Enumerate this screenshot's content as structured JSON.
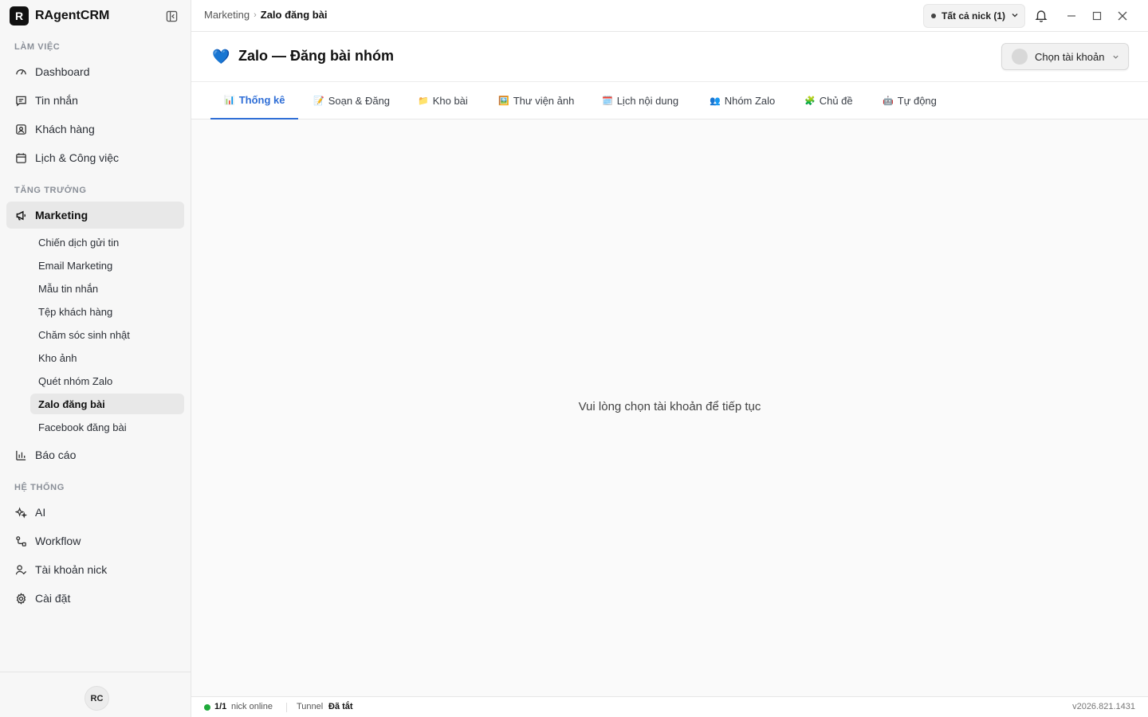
{
  "app": {
    "logo_letter": "R",
    "name": "RAgentCRM"
  },
  "sidebar": {
    "sections": [
      {
        "label": "LÀM VIỆC"
      },
      {
        "label": "TĂNG TRƯỞNG"
      },
      {
        "label": "HỆ THỐNG"
      }
    ],
    "items": [
      {
        "label": "Dashboard",
        "icon": "dashboard-icon"
      },
      {
        "label": "Tin nhắn",
        "icon": "message-icon"
      },
      {
        "label": "Khách hàng",
        "icon": "contact-icon"
      },
      {
        "label": "Lịch & Công việc",
        "icon": "calendar-icon"
      },
      {
        "label": "Marketing",
        "icon": "megaphone-icon"
      },
      {
        "label": "Báo cáo",
        "icon": "bar-chart-icon"
      },
      {
        "label": "AI",
        "icon": "sparkles-icon"
      },
      {
        "label": "Workflow",
        "icon": "workflow-icon"
      },
      {
        "label": "Tài khoản nick",
        "icon": "user-check-icon"
      },
      {
        "label": "Cài đặt",
        "icon": "gear-icon"
      }
    ],
    "marketing_sub": [
      {
        "label": "Chiến dịch gửi tin"
      },
      {
        "label": "Email Marketing"
      },
      {
        "label": "Mẫu tin nhắn"
      },
      {
        "label": "Tệp khách hàng"
      },
      {
        "label": "Chăm sóc sinh nhật"
      },
      {
        "label": "Kho ảnh"
      },
      {
        "label": "Quét nhóm Zalo"
      },
      {
        "label": "Zalo đăng bài"
      },
      {
        "label": "Facebook đăng bài"
      }
    ],
    "user_initials": "RC"
  },
  "topbar": {
    "breadcrumb_parent": "Marketing",
    "breadcrumb_sep": "›",
    "breadcrumb_current": "Zalo đăng bài",
    "nick_filter": "Tất cả nick (1)"
  },
  "page": {
    "icon": "💙",
    "title": "Zalo — Đăng bài nhóm",
    "account_select": "Chọn tài khoản"
  },
  "tabs": [
    {
      "emoji": "📊",
      "label": "Thống kê"
    },
    {
      "emoji": "📝",
      "label": "Soạn & Đăng"
    },
    {
      "emoji": "📁",
      "label": "Kho bài"
    },
    {
      "emoji": "🖼️",
      "label": "Thư viện ảnh"
    },
    {
      "emoji": "🗓️",
      "label": "Lịch nội dung"
    },
    {
      "emoji": "👥",
      "label": "Nhóm Zalo"
    },
    {
      "emoji": "🧩",
      "label": "Chủ đề"
    },
    {
      "emoji": "🤖",
      "label": "Tự động"
    }
  ],
  "content": {
    "empty_message": "Vui lòng chọn tài khoản để tiếp tục"
  },
  "statusbar": {
    "nick_count": "1/1",
    "nick_online_label": "nick online",
    "tunnel_label": "Tunnel",
    "tunnel_value": "Đã tắt",
    "version": "v2026.821.1431"
  },
  "colors": {
    "accent": "#2f6ed6",
    "online": "#1faa3b"
  }
}
